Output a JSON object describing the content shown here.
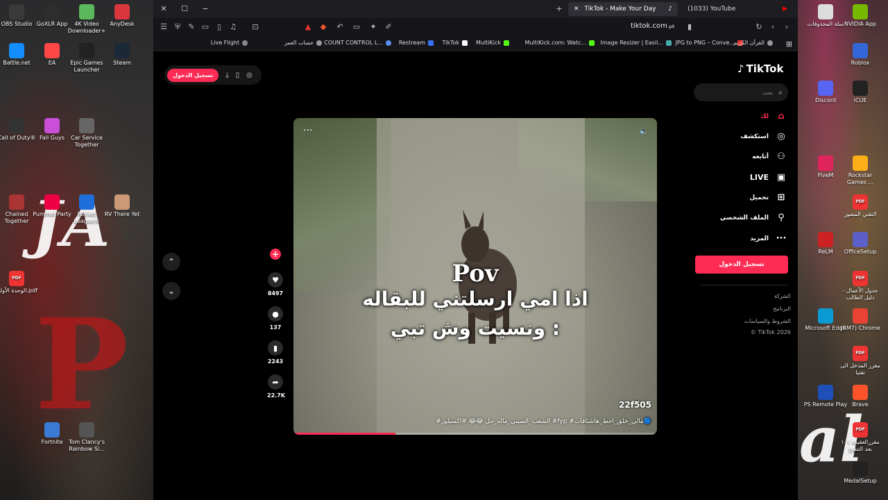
{
  "desktop": {
    "left_icons": [
      {
        "label": "OBS Studio",
        "icon": "obs-icon",
        "color": "#3a3a3a"
      },
      {
        "label": "GoXLR App",
        "icon": "goxlr-icon",
        "color": "#2d2d2d"
      },
      {
        "label": "4K Video Downloader+",
        "icon": "download-icon",
        "color": "#5cb85c"
      },
      {
        "label": "AnyDesk",
        "icon": "anydesk-icon",
        "color": "#d9363e"
      },
      {
        "label": "Battle.net",
        "icon": "battlenet-icon",
        "color": "#148eff"
      },
      {
        "label": "EA",
        "icon": "ea-icon",
        "color": "#ff4747"
      },
      {
        "label": "Epic Games Launcher",
        "icon": "epic-icon",
        "color": "#222"
      },
      {
        "label": "Steam",
        "icon": "steam-icon",
        "color": "#1b2838"
      },
      {
        "label": "Call of Duty®",
        "icon": "cod-icon",
        "color": "#333"
      },
      {
        "label": "Fall Guys",
        "icon": "fallguys-icon",
        "color": "#c94fd8"
      },
      {
        "label": "Car Service Together",
        "icon": "carservice-icon",
        "color": "#666"
      },
      {
        "label": "Chained Together",
        "icon": "chained-icon",
        "color": "#a33"
      },
      {
        "label": "Pummel Party",
        "icon": "pummel-icon",
        "color": "#e04"
      },
      {
        "label": "Rocket League®",
        "icon": "rocketleague-icon",
        "color": "#1e6fd9"
      },
      {
        "label": "RV There Yet",
        "icon": "rv-icon",
        "color": "#c97"
      },
      {
        "label": "الوحدة الأولى.pdf",
        "icon": "pdf-icon",
        "color": "#e33"
      },
      {
        "label": "Fortnite",
        "icon": "fortnite-icon",
        "color": "#3a7bd5"
      },
      {
        "label": "Tom Clancy's Rainbow Si...",
        "icon": "rainbow-icon",
        "color": "#555"
      }
    ],
    "right_icons": [
      {
        "label": "سلة المحذوفات",
        "icon": "recycle-bin-icon",
        "color": "#ddd"
      },
      {
        "label": "NVIDIA App",
        "icon": "nvidia-icon",
        "color": "#76b900"
      },
      {
        "label": "Roblox",
        "icon": "roblox-icon",
        "color": "#3466d8"
      },
      {
        "label": "Discord",
        "icon": "discord-icon",
        "color": "#5865f2"
      },
      {
        "label": "iCUE",
        "icon": "icue-icon",
        "color": "#222"
      },
      {
        "label": "FiveM",
        "icon": "fivem-icon",
        "color": "#e0245e"
      },
      {
        "label": "Rockstar Games ...",
        "icon": "rockstar-icon",
        "color": "#fcaf17"
      },
      {
        "label": "التقني المصور",
        "icon": "pdf-icon",
        "color": "#e33"
      },
      {
        "label": "ReLM",
        "icon": "relm-icon",
        "color": "#c22"
      },
      {
        "label": "OfficeSetup",
        "icon": "office-icon",
        "color": "#5b5fc7"
      },
      {
        "label": "جدول الأعمال - دليل الطالب",
        "icon": "pdf-icon",
        "color": "#e33"
      },
      {
        "label": "Microsoft Edge",
        "icon": "edge-icon",
        "color": "#0c9ad3"
      },
      {
        "label": "(RM7) Chrome",
        "icon": "chrome-icon",
        "color": "#ea4335"
      },
      {
        "label": "مقرر المدخل الى تقنيا",
        "icon": "pdf-icon",
        "color": "#e33"
      },
      {
        "label": "PS Remote Play",
        "icon": "psremote-icon",
        "color": "#1f4fb8"
      },
      {
        "label": "Brave",
        "icon": "brave-icon",
        "color": "#fb542b"
      },
      {
        "label": "مقررالعقيدة ١٠١ بعد التنقيح",
        "icon": "pdf-icon",
        "color": "#e33"
      },
      {
        "label": "MedalSetup",
        "icon": "medal-icon",
        "color": "#222"
      }
    ]
  },
  "browser": {
    "tabs": [
      {
        "label": "TikTok - Make Your Day",
        "active": true
      },
      {
        "label": "(1033) YouTube",
        "active": false
      }
    ],
    "url": "tiktok.com",
    "bookmarks": [
      {
        "label": "Live Flight",
        "color": "#888"
      },
      {
        "label": "حساب العمر",
        "color": "#999"
      },
      {
        "label": "COUNT CONTROL L...",
        "color": "#5b8def"
      },
      {
        "label": "Restream",
        "color": "#3a6ff7"
      },
      {
        "label": "TikTok",
        "color": "#111"
      },
      {
        "label": "MultiKick",
        "color": "#53fc18"
      },
      {
        "label": "MultiKick.com: Watc...",
        "color": "#53fc18"
      },
      {
        "label": "Image Resizer | Easil...",
        "color": "#4aa"
      },
      {
        "label": "JPG to PNG – Conve...",
        "color": "#e33"
      },
      {
        "label": "القرآن الكريم",
        "color": "#999"
      }
    ]
  },
  "tiktok": {
    "logo": "TikTok",
    "search_placeholder": "بحث",
    "login_top": "تسجيل الدخول",
    "nav": [
      {
        "label": "لك",
        "icon": "home-icon",
        "active": true
      },
      {
        "label": "استكشف",
        "icon": "compass-icon",
        "active": false
      },
      {
        "label": "أتابعه",
        "icon": "user-plus-icon",
        "active": false
      },
      {
        "label": "LIVE",
        "icon": "live-icon",
        "active": false
      },
      {
        "label": "تحميل",
        "icon": "upload-icon",
        "active": false
      },
      {
        "label": "الملف الشخصي",
        "icon": "profile-icon",
        "active": false
      },
      {
        "label": "المزيد",
        "icon": "more-icon",
        "active": false
      }
    ],
    "login_side": "تسجيل الدخول",
    "footer": [
      "الشركة",
      "البرنامج",
      "الشروط والسياسات",
      "© TikTok 2026"
    ],
    "video": {
      "caption_line1": "Pov",
      "caption_line2": "اذا امي ارسلتني للبقاله",
      "caption_line3": "ونسيت وش تبي :",
      "watermark": "22f505",
      "hashtags": "#الشعب_الصيني_ماله_حل 😂😂 #اكسبلور #fyp #مالي_خلق_احط_هاشتاقات🔵",
      "progress": 0.28
    },
    "actions": {
      "likes": "8497",
      "comments": "137",
      "saves": "2243",
      "shares": "22.7K"
    },
    "colors": {
      "accent": "#fe2c55",
      "bg": "#000000"
    }
  }
}
